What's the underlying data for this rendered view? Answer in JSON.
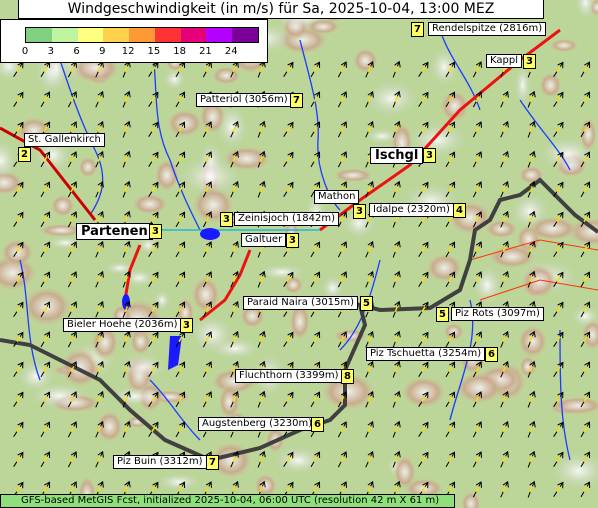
{
  "title": "Windgeschwindigkeit (in m/s) für Sa, 2025-10-04, 13:00 MEZ",
  "legend": {
    "ticks": [
      "0",
      "3",
      "6",
      "9",
      "12",
      "15",
      "18",
      "21",
      "24"
    ],
    "colors": [
      "#7fd17f",
      "#bff5a0",
      "#ffff80",
      "#ffd24d",
      "#ff9933",
      "#ff3333",
      "#e6007a",
      "#b300ff",
      "#7a0099"
    ]
  },
  "places": [
    {
      "name": "Rendelspitze (2816m)",
      "value": "7"
    },
    {
      "name": "Kappl",
      "value": "3"
    },
    {
      "name": "Patteriol (3056m)",
      "value": "7"
    },
    {
      "name": "St. Gallenkirch",
      "value": "2"
    },
    {
      "name": "Ischgl",
      "value": "3"
    },
    {
      "name": "Mathon",
      "value": "3"
    },
    {
      "name": "Idalpe (2320m)",
      "value": "4"
    },
    {
      "name": "Zeinisjoch (1842m)",
      "value": "3"
    },
    {
      "name": "Partenen",
      "value": "3"
    },
    {
      "name": "Galtuer",
      "value": "3"
    },
    {
      "name": "Paraid Naira (3015m)",
      "value": "5"
    },
    {
      "name": "Piz Rots (3097m)",
      "value": "5"
    },
    {
      "name": "Bieler Hoehe (2036m)",
      "value": "3"
    },
    {
      "name": "Piz Tschuetta (3254m)",
      "value": "6"
    },
    {
      "name": "Fluchthorn (3399m)",
      "value": "8"
    },
    {
      "name": "Augstenberg (3230m)",
      "value": "6"
    },
    {
      "name": "Piz Buin (3312m)",
      "value": "7"
    }
  ],
  "footer": "GFS-based MetGIS Fcst, initialized 2025-10-04, 06:00 UTC  (resolution 42 m X 61 m)"
}
